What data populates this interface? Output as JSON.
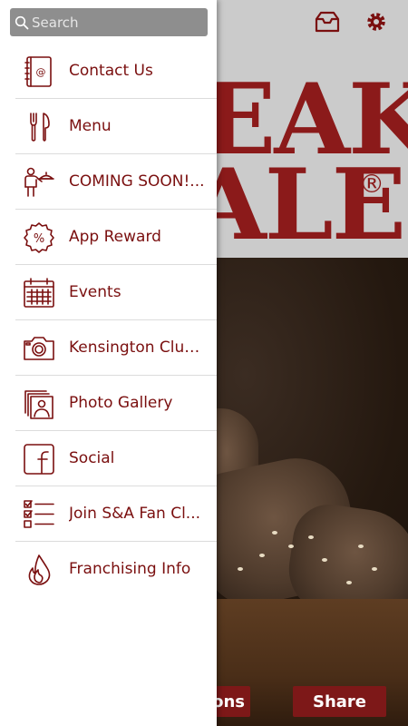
{
  "header": {
    "icons": [
      "inbox-icon",
      "settings-gear-icon"
    ]
  },
  "banner": {
    "brand_line_1": "EAK",
    "brand_line_2": "ALE",
    "registered_mark": "®"
  },
  "bottom_bar": {
    "left_button_label": "ons",
    "share_label": "Share"
  },
  "search": {
    "placeholder": "Search",
    "value": ""
  },
  "menu": {
    "items": [
      {
        "label": "Contact Us",
        "icon": "address-book-icon"
      },
      {
        "label": "Menu",
        "icon": "fork-knife-icon"
      },
      {
        "label": "COMING SOON!...",
        "icon": "waiter-serving-icon"
      },
      {
        "label": "App Reward",
        "icon": "percent-badge-icon"
      },
      {
        "label": "Events",
        "icon": "calendar-icon"
      },
      {
        "label": "Kensington Club...",
        "icon": "camera-icon"
      },
      {
        "label": "Photo Gallery",
        "icon": "photo-stack-icon"
      },
      {
        "label": "Social",
        "icon": "facebook-icon"
      },
      {
        "label": "Join S&A Fan Cl...",
        "icon": "checklist-icon"
      },
      {
        "label": "Franchising Info",
        "icon": "flame-icon"
      }
    ]
  },
  "colors": {
    "brand": "#7a0f0f",
    "search_bg": "#8e8e8e",
    "banner_bg": "#cbcbcb",
    "button_bg": "#7d1818"
  }
}
